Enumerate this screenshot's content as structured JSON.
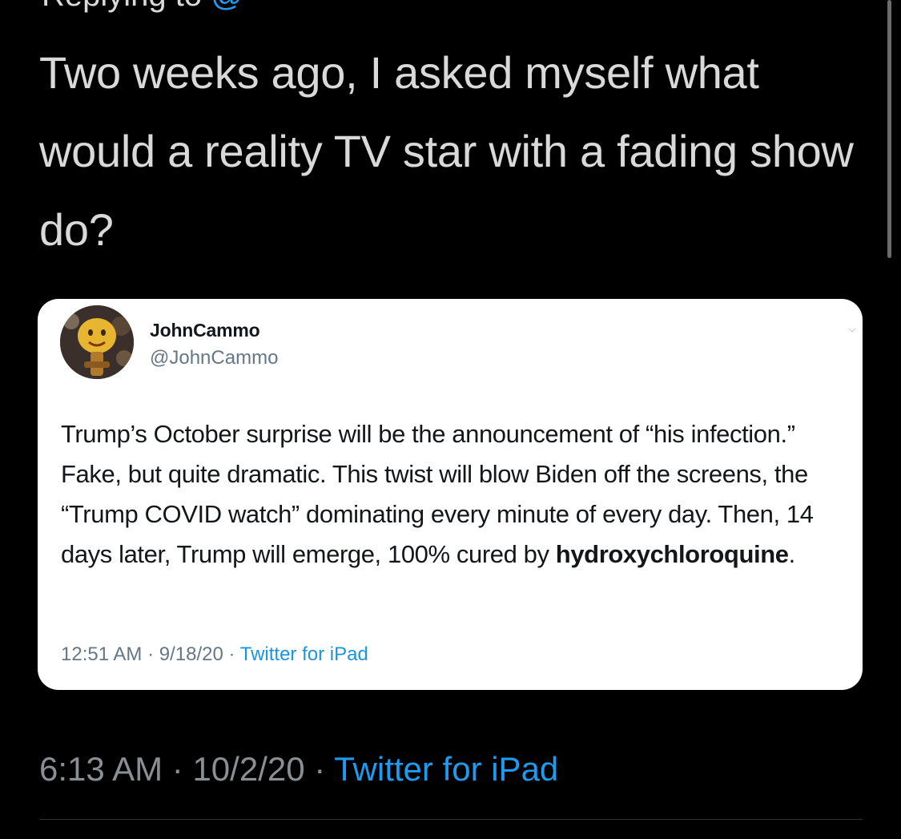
{
  "top_partial": {
    "prefix": "Replying to",
    "handle": "@"
  },
  "tweet": {
    "text": "Two weeks ago, I asked myself what would a reality TV star with a fading show do?",
    "time": "6:13 AM",
    "separator": "·",
    "date": "10/2/20",
    "source": "Twitter for iPad"
  },
  "quoted_tweet": {
    "display_name": "JohnCammo",
    "handle": "@JohnCammo",
    "body_main": "Trump’s October surprise will be the announcement of “his infection.”  Fake, but quite dramatic. This twist will blow Biden off the screens, the “Trump COVID watch” dominating every minute of every day.  Then, 14 days later, Trump will emerge, 100% cured by ",
    "body_bold": "hydroxychloroquine",
    "body_end": ".",
    "time": "12:51 AM",
    "separator": "·",
    "date": "9/18/20",
    "source": "Twitter for iPad"
  },
  "colors": {
    "background": "#000000",
    "link": "#1d9bf0",
    "card": "#ffffff"
  },
  "icons": [
    "avatar-image",
    "chevron-down-icon"
  ]
}
